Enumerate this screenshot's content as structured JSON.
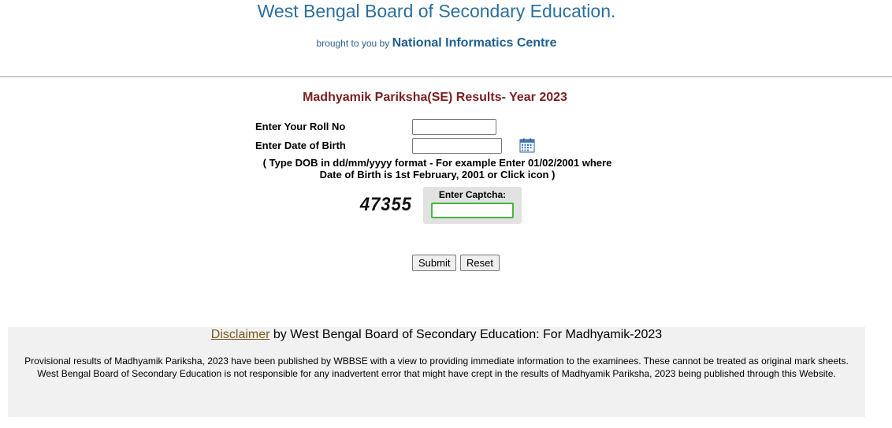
{
  "header": {
    "title": "West Bengal Board of Secondary Education.",
    "brought_prefix": "brought to you by",
    "brought_org": "National Informatics Centre"
  },
  "form": {
    "title": "Madhyamik Pariksha(SE) Results- Year 2023",
    "roll_label": "Enter Your Roll No",
    "roll_value": "",
    "dob_label": "Enter Date of Birth",
    "dob_value": "",
    "dob_hint_line1": "( Type DOB in dd/mm/yyyy format - For example Enter 01/02/2001 where",
    "dob_hint_line2": "Date of Birth is 1st February, 2001 or Click icon   )",
    "captcha_code": "47355",
    "captcha_label": "Enter Captcha:",
    "captcha_value": "",
    "submit_label": "Submit",
    "reset_label": "Reset"
  },
  "disclaimer": {
    "link_text": "Disclaimer",
    "heading_rest": " by West Bengal Board of Secondary Education: For Madhyamik-2023",
    "body": "Provisional results of Madhyamik Pariksha, 2023 have been published by WBBSE with a view to providing immediate information to the examinees. These cannot be treated as original mark sheets. West Bengal Board of Secondary Education is not responsible for any inadvertent error that might have crept in the results of Madhyamik Pariksha, 2023 being published through this Website."
  },
  "colors": {
    "title_blue": "#2b6f9c",
    "exam_title_maroon": "#7a1f1f",
    "captcha_focus_green": "#46b83c",
    "disclaimer_bg": "#f1f1f1"
  },
  "icons": {
    "calendar": "calendar-icon"
  }
}
